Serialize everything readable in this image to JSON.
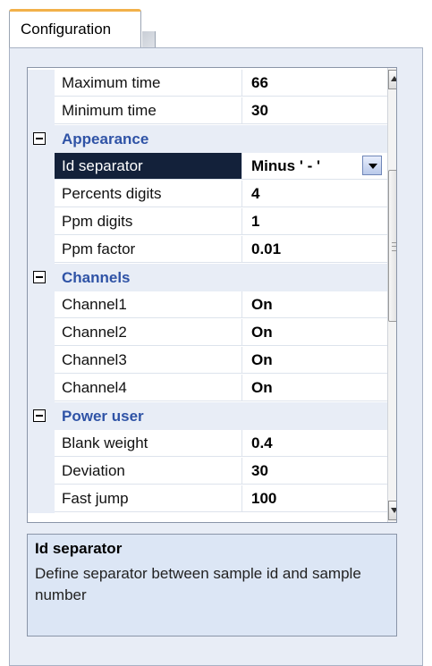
{
  "tab": {
    "label": "Configuration"
  },
  "grid": {
    "rows": [
      {
        "kind": "prop",
        "name": "Maximum time",
        "value": "66"
      },
      {
        "kind": "prop",
        "name": "Minimum time",
        "value": "30"
      },
      {
        "kind": "category",
        "name": "Appearance"
      },
      {
        "kind": "prop",
        "name": "Id separator",
        "value": "Minus ' - '",
        "selected": true
      },
      {
        "kind": "prop",
        "name": "Percents digits",
        "value": "4"
      },
      {
        "kind": "prop",
        "name": "Ppm digits",
        "value": "1"
      },
      {
        "kind": "prop",
        "name": "Ppm factor",
        "value": "0.01"
      },
      {
        "kind": "category",
        "name": "Channels"
      },
      {
        "kind": "prop",
        "name": "Channel1",
        "value": "On"
      },
      {
        "kind": "prop",
        "name": "Channel2",
        "value": "On"
      },
      {
        "kind": "prop",
        "name": "Channel3",
        "value": "On"
      },
      {
        "kind": "prop",
        "name": "Channel4",
        "value": "On"
      },
      {
        "kind": "category",
        "name": "Power user"
      },
      {
        "kind": "prop",
        "name": "Blank weight",
        "value": "0.4"
      },
      {
        "kind": "prop",
        "name": "Deviation",
        "value": "30"
      },
      {
        "kind": "prop",
        "name": "Fast jump",
        "value": "100"
      }
    ]
  },
  "description": {
    "title": "Id separator",
    "text": "Define separator between sample id and sample number"
  },
  "colors": {
    "category_text": "#2f53a6",
    "selected_bg": "#13213a",
    "panel_bg": "#e8edf6",
    "tab_accent": "#f2b14a"
  },
  "icons": [
    "collapse-icon",
    "dropdown-arrow-icon",
    "scroll-up-icon",
    "scroll-down-icon"
  ]
}
